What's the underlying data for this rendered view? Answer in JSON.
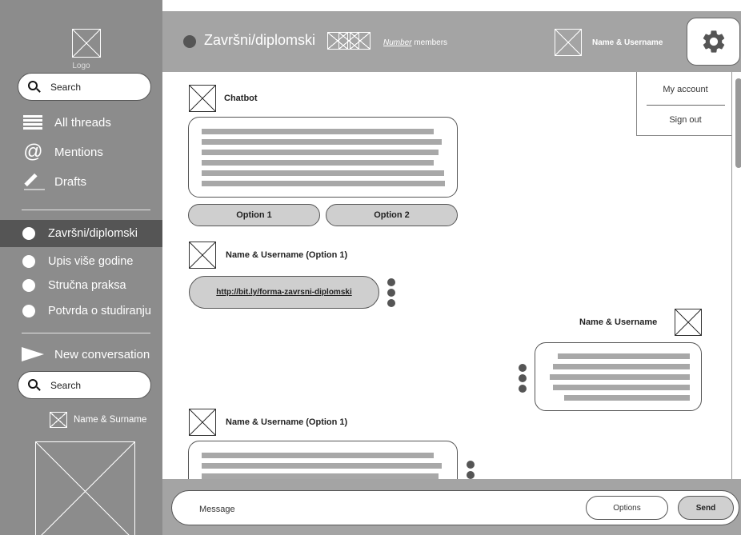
{
  "sidebar": {
    "logo_text": "Logo",
    "search_top_placeholder": "Search",
    "nav": [
      {
        "label": "All threads",
        "icon": "list-icon"
      },
      {
        "label": "Mentions",
        "icon": "at-icon"
      },
      {
        "label": "Drafts",
        "icon": "pencil-icon"
      }
    ],
    "channels": [
      {
        "label": "Završni/diplomski",
        "active": true
      },
      {
        "label": "Upis više godine",
        "active": false
      },
      {
        "label": "Stručna praksa",
        "active": false
      },
      {
        "label": "Potvrda o studiranju",
        "active": false
      }
    ],
    "new_conversation_label": "New conversation",
    "search_bottom_placeholder": "Search",
    "user_name": "Name & Surname"
  },
  "header": {
    "title": "Završni/diplomski",
    "members_number": "Number",
    "members_suffix": " members",
    "username": "Name & Username",
    "settings_icon": "gear-icon"
  },
  "account_menu": {
    "items": [
      "My account",
      "Sign out"
    ]
  },
  "chat": {
    "chatbot_sender": "Chatbot",
    "options": [
      "Option 1",
      "Option 2"
    ],
    "reply1_sender": "Name & Username (Option 1)",
    "link": "http://bit.ly/forma-zavrsni-diplomski",
    "self_sender": "Name & Username",
    "reply2_sender": "Name & Username (Option 1)"
  },
  "composer": {
    "placeholder": "Message",
    "options_label": "Options",
    "send_label": "Send"
  },
  "colors": {
    "sidebar_bg": "#8c8c8c",
    "sidebar_active": "#555555",
    "header_bg": "#a4a4a4",
    "placeholder_line": "#a8a8a8"
  }
}
